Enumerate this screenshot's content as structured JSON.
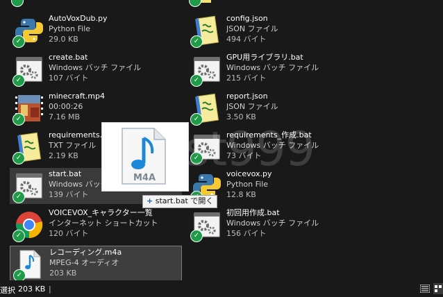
{
  "files_left": [
    {
      "name": "AutoVoxDub.py",
      "type": "Python File",
      "size": "29.0 KB",
      "icon": "python-icon"
    },
    {
      "name": "create.bat",
      "type": "Windows バッチ ファイル",
      "size": "107 バイト",
      "icon": "batch-gear-icon"
    },
    {
      "name": "minecraft.mp4",
      "type": "00:00:26",
      "size": "7.16 MB",
      "icon": "video-thumbnail-icon"
    },
    {
      "name": "requirements.t",
      "type": "TXT ファイル",
      "size": "2.19 KB",
      "icon": "notepad-icon"
    },
    {
      "name": "start.bat",
      "type": "Windows バッチ",
      "size": "139 バイト",
      "icon": "batch-gear-icon"
    },
    {
      "name": "VOICEVOX_キャラクター一覧",
      "type": "インターネット ショートカット",
      "size": "120 バイト",
      "icon": "chrome-icon"
    },
    {
      "name": "レコーディング.m4a",
      "type": "MPEG-4 オーディオ",
      "size": "203 KB",
      "icon": "audio-file-icon"
    }
  ],
  "files_right": [
    {
      "name": "config.json",
      "type": "JSON ファイル",
      "size": "494 バイト",
      "icon": "notepad-icon"
    },
    {
      "name": "GPU用ライブラリ.bat",
      "type": "Windows バッチ ファイル",
      "size": "215 バイト",
      "icon": "batch-gear-icon"
    },
    {
      "name": "report.json",
      "type": "JSON ファイル",
      "size": "3.50 KB",
      "icon": "notepad-icon"
    },
    {
      "name": "requirements_作成.bat",
      "type": "Windows バッチ ファイル",
      "size": "73 バイト",
      "icon": "batch-gear-icon"
    },
    {
      "name": "voicevox.py",
      "type": "Python File",
      "size": "12.8 KB",
      "icon": "python-icon"
    },
    {
      "name": "初回用作成.bat",
      "type": "Windows バッチ ファイル",
      "size": "156 バイト",
      "icon": "batch-gear-icon"
    }
  ],
  "drag": {
    "file_label": "M4A",
    "tooltip_plus": "+",
    "tooltip_text": "start.bat で開く"
  },
  "watermark": "Rest999",
  "status": {
    "selected": "選択",
    "size": "203 KB",
    "separator": "|"
  },
  "colors": {
    "background": "#191919",
    "check": "#1e9c47",
    "selection": "#3e3e3e",
    "audio_blue": "#1e88d8"
  }
}
